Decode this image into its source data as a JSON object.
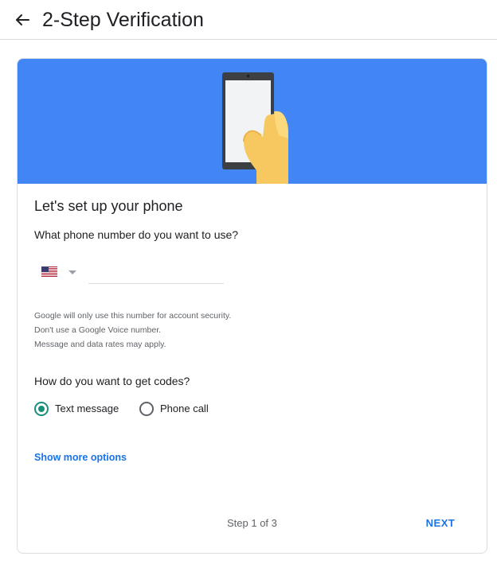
{
  "header": {
    "title": "2-Step Verification",
    "back_icon": "arrow-back-icon"
  },
  "card": {
    "banner_color": "#4285f4",
    "title": "Let's set up your phone",
    "phone_question": "What phone number do you want to use?",
    "country": {
      "flag_icon": "us-flag-icon",
      "caret_icon": "caret-down-icon"
    },
    "phone_input": {
      "value": "",
      "placeholder": ""
    },
    "notes": [
      "Google will only use this number for account security.",
      "Don't use a Google Voice number.",
      "Message and data rates may apply."
    ],
    "codes_question": "How do you want to get codes?",
    "options": [
      {
        "label": "Text message",
        "checked": true
      },
      {
        "label": "Phone call",
        "checked": false
      }
    ],
    "show_more_label": "Show more options",
    "step_label": "Step 1 of 3",
    "next_label": "NEXT"
  },
  "colors": {
    "accent": "#1a73e8",
    "radio_checked": "#1a8e7c",
    "banner": "#4285f4"
  }
}
